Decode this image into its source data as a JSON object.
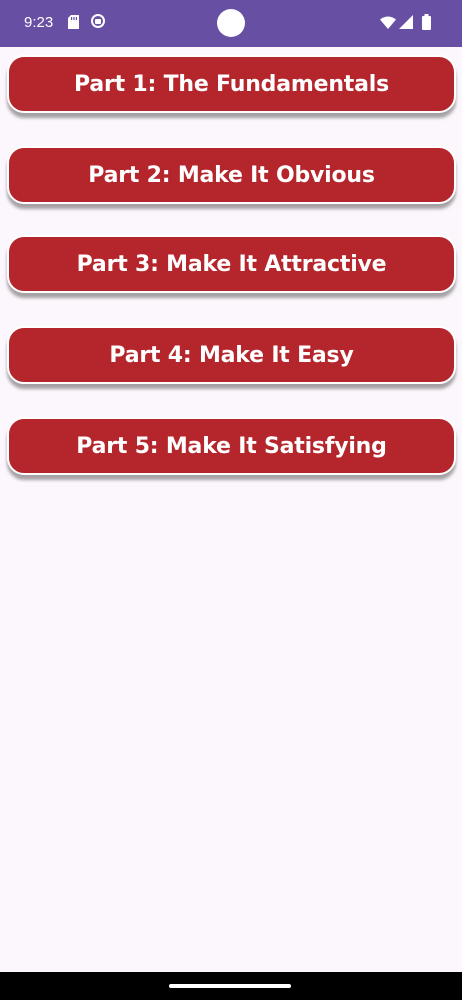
{
  "status_bar": {
    "time": "9:23",
    "icons": [
      "sd-card-icon",
      "app-notification-icon",
      "wifi-icon",
      "signal-icon",
      "battery-icon"
    ]
  },
  "parts": [
    {
      "label": "Part 1: The Fundamentals"
    },
    {
      "label": "Part 2: Make It Obvious"
    },
    {
      "label": "Part 3: Make It Attractive"
    },
    {
      "label": "Part 4: Make It Easy"
    },
    {
      "label": "Part 5: Make It Satisfying"
    }
  ],
  "colors": {
    "status_bar": "#6750a4",
    "button": "#b5262c",
    "background": "#fcf7fc"
  }
}
